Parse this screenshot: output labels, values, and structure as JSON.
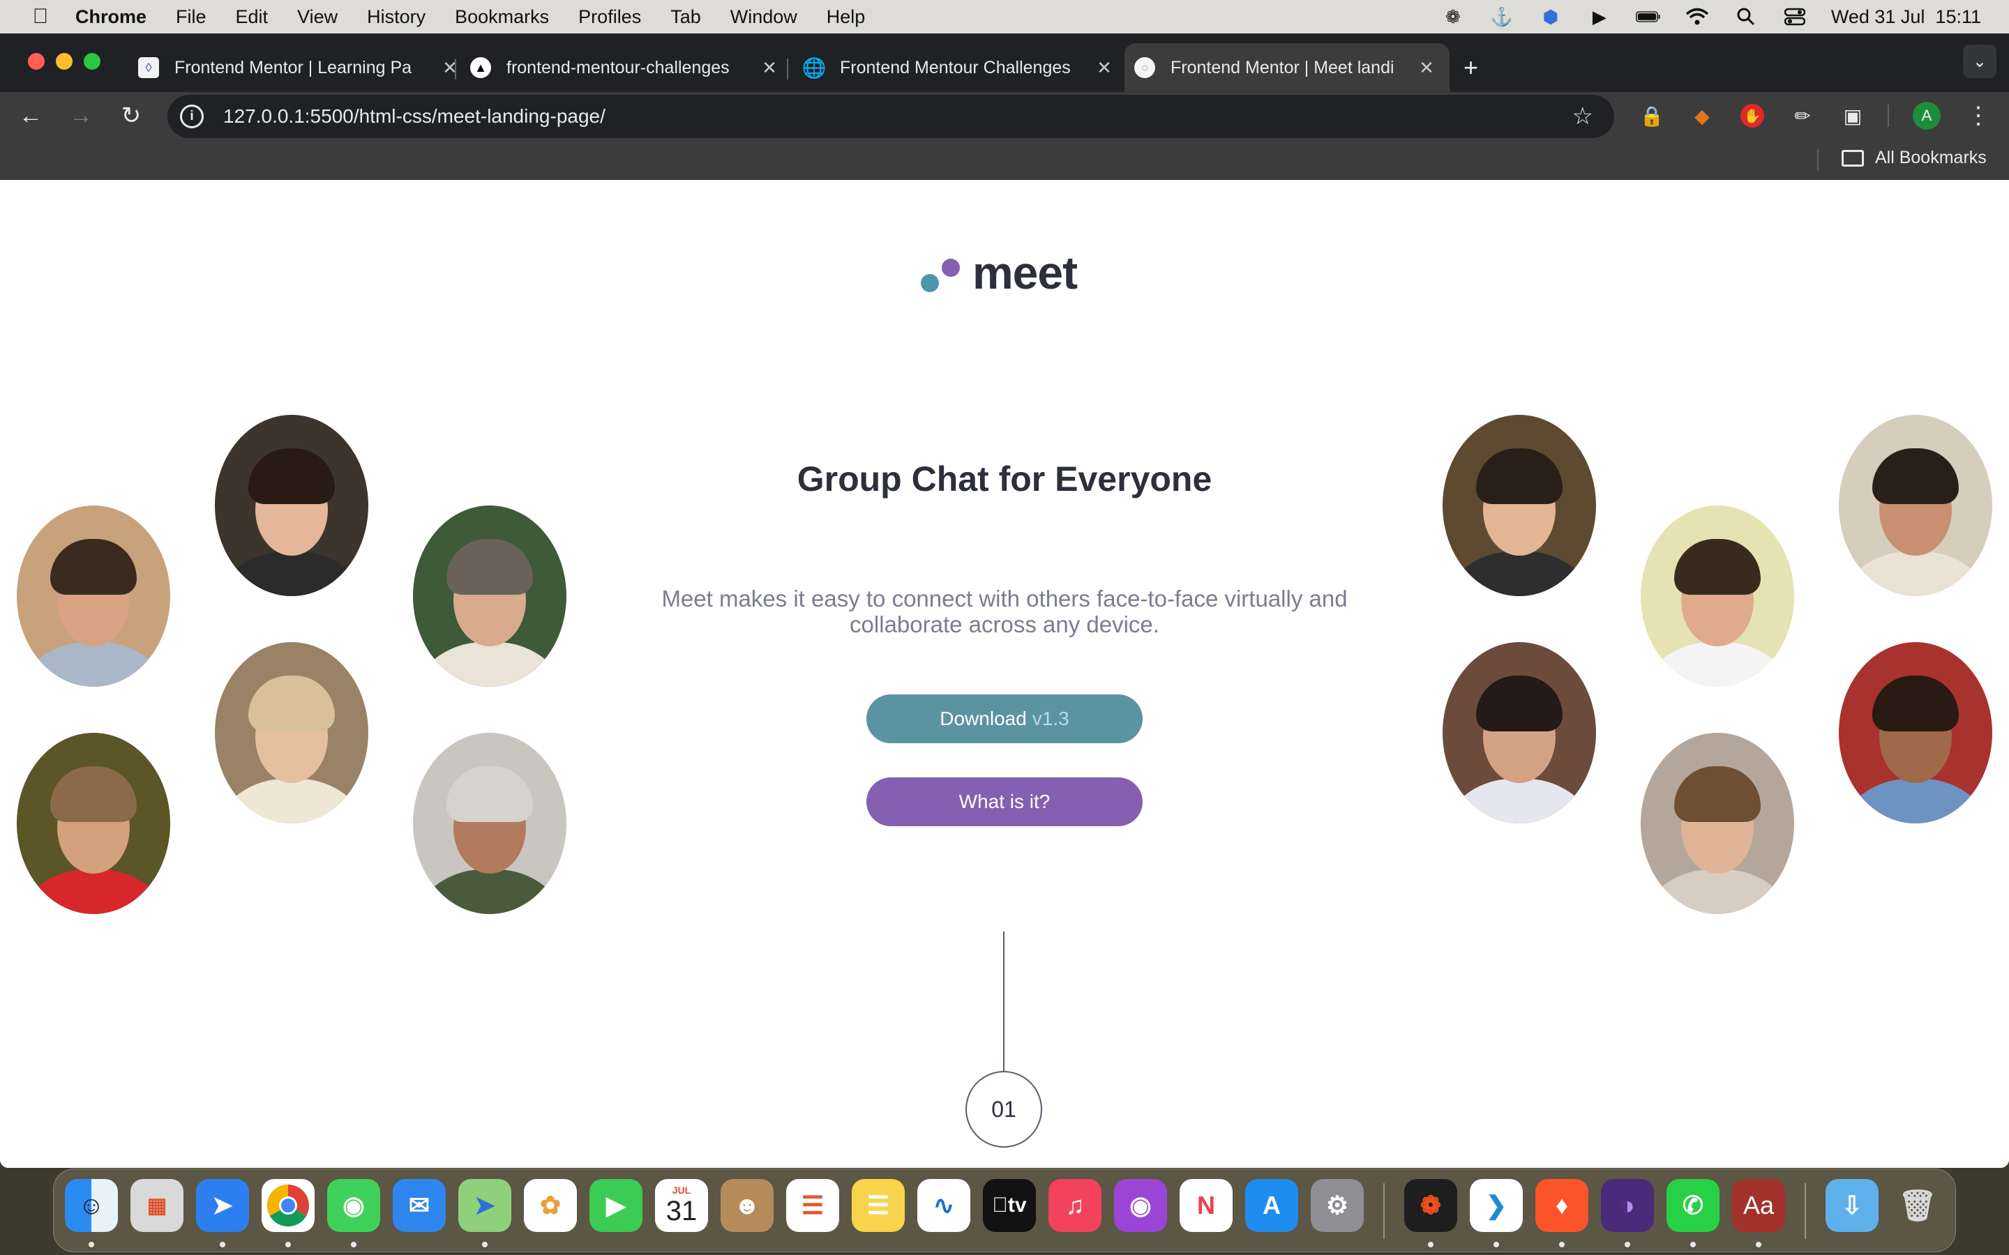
{
  "menubar": {
    "app": "Chrome",
    "items": [
      "File",
      "Edit",
      "View",
      "History",
      "Bookmarks",
      "Profiles",
      "Tab",
      "Window",
      "Help"
    ],
    "clock": "Wed 31 Jul  15:11"
  },
  "tabs": [
    {
      "title": "Frontend Mentor | Learning Pa",
      "active": false
    },
    {
      "title": "frontend-mentour-challenges",
      "active": false
    },
    {
      "title": "Frontend Mentour Challenges",
      "active": false
    },
    {
      "title": "Frontend Mentor | Meet landi",
      "active": true
    }
  ],
  "toolbar": {
    "url": "127.0.0.1:5500/html-css/meet-landing-page/",
    "profile_initial": "A"
  },
  "bookmarks": {
    "all_label": "All Bookmarks"
  },
  "page": {
    "logo_text": "meet",
    "headline": "Group Chat for Everyone",
    "description": "Meet makes it easy to connect with others face-to-face virtually and collaborate across any device.",
    "download_label": "Download",
    "download_version": "v1.3",
    "what_label": "What is it?",
    "step_number": "01"
  },
  "colors": {
    "accent_cyan": "#4d96a9",
    "accent_purple": "#855fb1",
    "heading": "#2d2f3b",
    "body_text": "#7b7d8f"
  },
  "dock": {
    "calendar_month": "JUL",
    "calendar_day": "31",
    "appletv_label": "tv",
    "dictionary_label": "Aa"
  }
}
